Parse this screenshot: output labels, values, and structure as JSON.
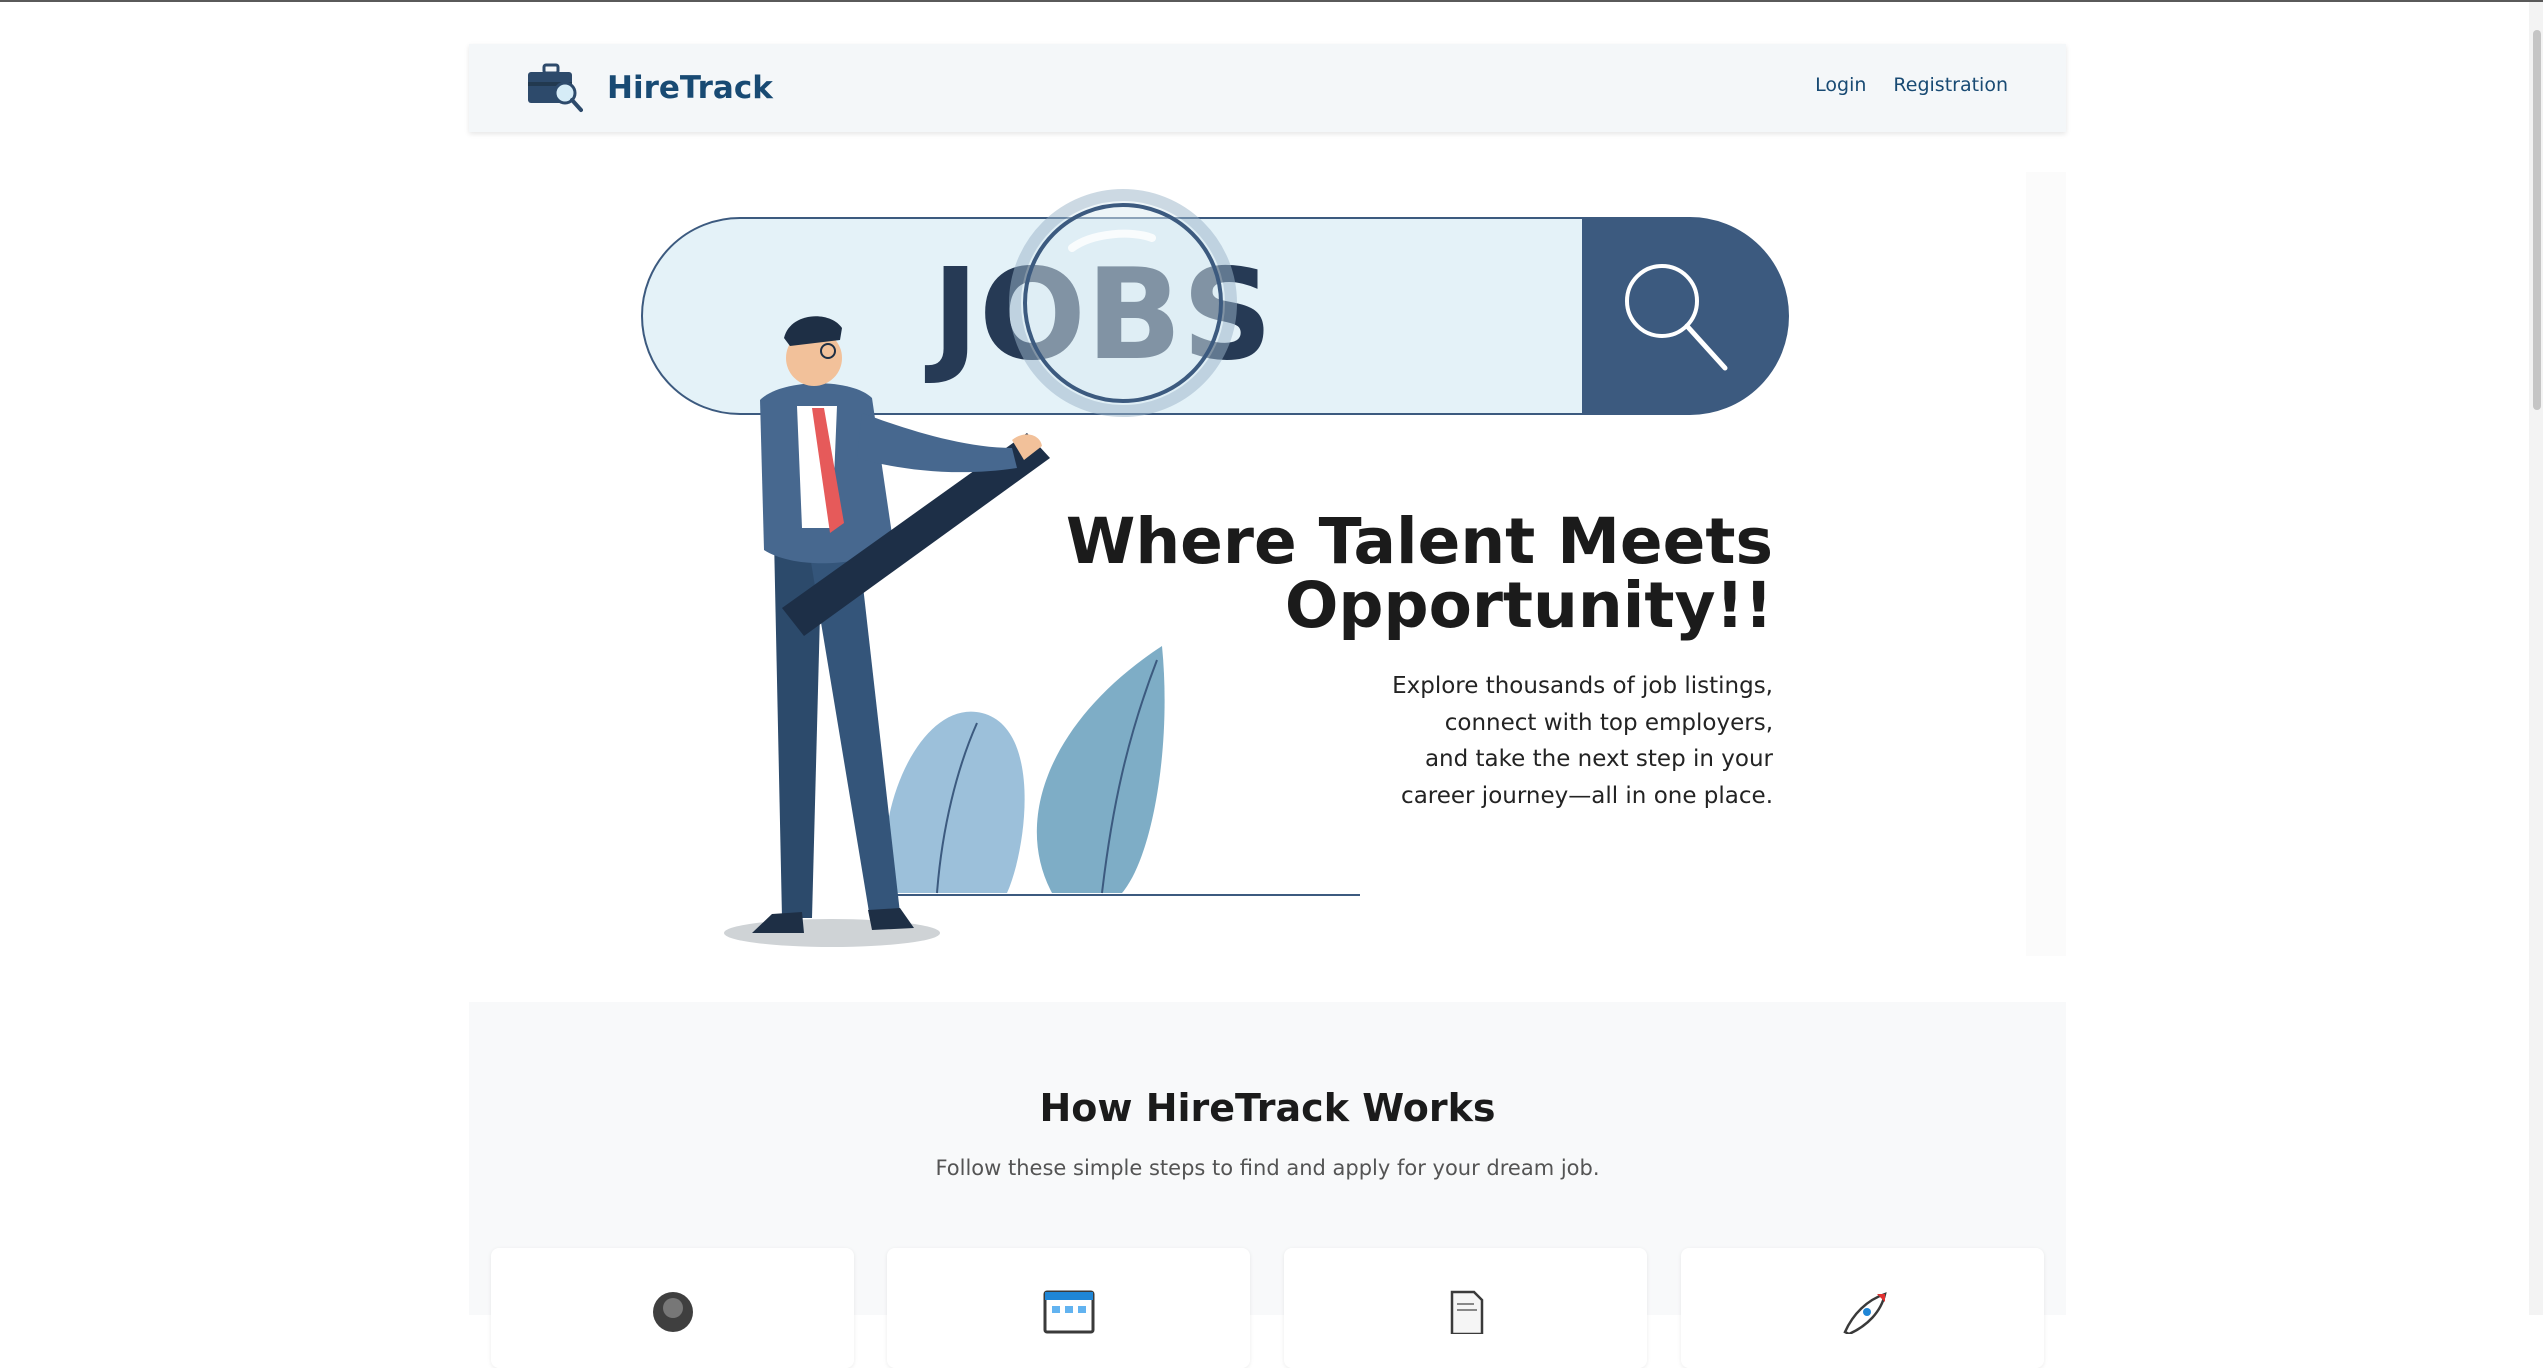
{
  "brand": {
    "name": "HireTrack",
    "icon": "briefcase-search-icon",
    "color": "#184a73"
  },
  "nav": {
    "links": [
      "Login",
      "Registration"
    ]
  },
  "hero": {
    "illustration_text": "JOBS",
    "title_line1": "Where Talent Meets",
    "title_line2": "Opportunity!!",
    "subtitle_lines": [
      "Explore thousands of job listings,",
      "connect with top employers,",
      "and take the next step in your",
      "career journey—all in one place."
    ]
  },
  "how_it_works": {
    "title": "How HireTrack Works",
    "subtitle": "Follow these simple steps to find and apply for your dream job.",
    "step_icons": [
      "person-icon",
      "browser-window-icon",
      "document-icon",
      "rocket-icon"
    ]
  },
  "colors": {
    "accent": "#184a73",
    "illustration_dark": "#3c5a7f",
    "tie": "#e65a5a"
  }
}
